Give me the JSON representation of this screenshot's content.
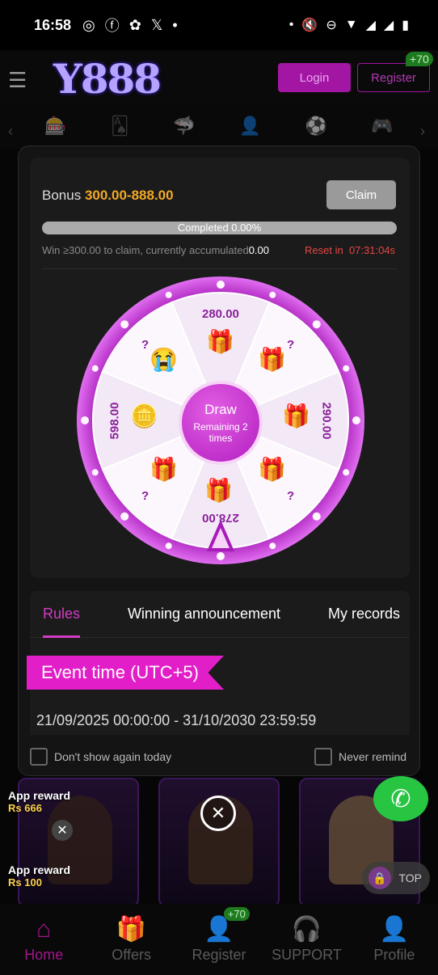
{
  "status_bar": {
    "time": "16:58",
    "icons": [
      "instagram-icon",
      "facebook-icon",
      "app-icon",
      "x-icon",
      "dot-icon"
    ],
    "right_icons": [
      "dot-icon",
      "mute-icon",
      "dnd-icon",
      "wifi-icon",
      "signal-icon",
      "signal-icon",
      "battery-icon"
    ]
  },
  "header": {
    "logo": "Y888",
    "login_label": "Login",
    "register_label": "Register",
    "register_badge": "+70"
  },
  "modal": {
    "bonus_prefix": "Bonus",
    "bonus_amount": "300.00-888.00",
    "claim_label": "Claim",
    "progress_label": "Completed 0.00%",
    "progress_value": 0.0,
    "win_note": "Win ≥300.00 to claim, currently accumulated",
    "accumulated": "0.00",
    "reset_label": "Reset in",
    "reset_time": "07:31:04s",
    "draw_label": "Draw",
    "remaining_label": "Remaining 2 times",
    "prizes": [
      "280.00",
      "?",
      "290.00",
      "?",
      "278.00",
      "?",
      "598.00",
      "?"
    ],
    "tabs": [
      "Rules",
      "Winning announcement",
      "My records"
    ],
    "active_tab": "Rules",
    "event_title": "Event time (UTC+5)",
    "event_time": "21/09/2025 00:00:00 - 31/10/2030 23:59:59",
    "dont_show_label": "Don't show again today",
    "never_remind_label": "Never remind"
  },
  "rewards": [
    {
      "label": "App reward",
      "amount": "Rs 666"
    },
    {
      "label": "App reward",
      "amount": "Rs 100"
    }
  ],
  "top_label": "TOP",
  "nav": {
    "items": [
      "Home",
      "Offers",
      "Register",
      "SUPPORT",
      "Profile"
    ],
    "register_badge": "+70",
    "active": "Home"
  },
  "colors": {
    "accent": "#d23cc2",
    "gold": "#f2a925",
    "reset_red": "#e64545",
    "wheel_purple": "#b11cc0"
  }
}
